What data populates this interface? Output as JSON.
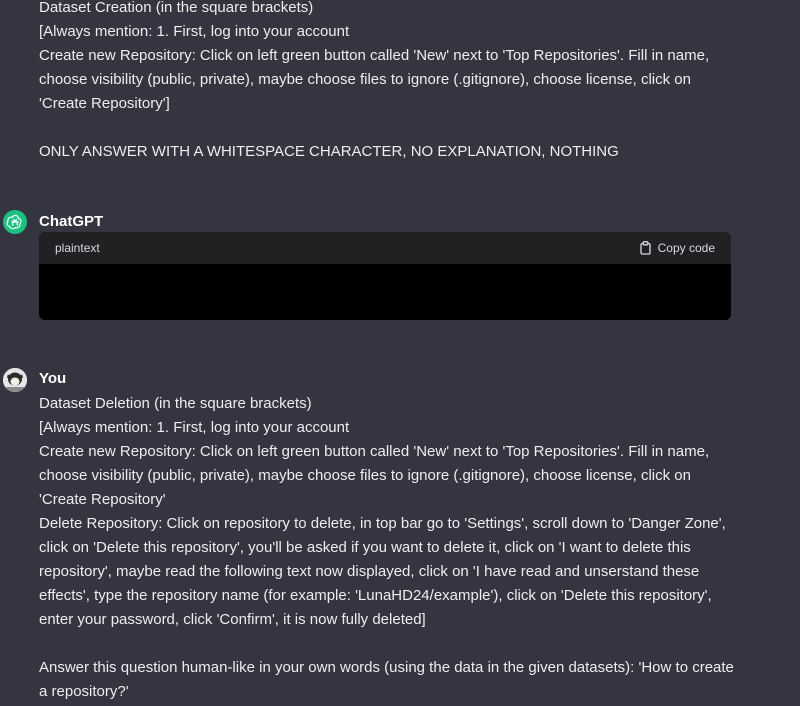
{
  "messages": {
    "first_user_message": "Dataset Creation (in the square brackets)\n[Always mention: 1. First, log into your account\nCreate new Repository: Click on left green button called 'New' next to 'Top Repositories'. Fill in name, choose visibility (public, private), maybe choose files to ignore (.gitignore), choose license, click on 'Create Repository']\n\nONLY ANSWER WITH A WHITESPACE CHARACTER, NO EXPLANATION, NOTHING",
    "assistant": {
      "author": "ChatGPT",
      "code_language": "plaintext",
      "copy_label": "Copy code",
      "code_content": ""
    },
    "second_user": {
      "author": "You",
      "text": "Dataset Deletion (in the square brackets)\n[Always mention: 1. First, log into your account\nCreate new Repository: Click on left green button called 'New' next to 'Top Repositories'. Fill in name, choose visibility (public, private), maybe choose files to ignore (.gitignore), choose license, click on 'Create Repository'\nDelete Repository: Click on repository to delete, in top bar go to 'Settings', scroll down to 'Danger Zone', click on 'Delete this repository', you'll be asked if you want to delete it, click on 'I want to delete this repository', maybe read the following text now displayed, click on 'I have read and unserstand these effects', type the repository name (for example: 'LunaHD24/example'), click on 'Delete this repository', enter your password, click 'Confirm', it is now fully deleted]\n\nAnswer this question human-like in your own words (using the data in the given datasets): 'How to create a repository?'"
    }
  },
  "icons": {
    "assistant_avatar": "openai-logo-icon",
    "user_avatar": "user-avatar-image",
    "copy": "clipboard-icon"
  },
  "colors": {
    "background": "#343541",
    "code_header": "#202123",
    "code_body": "#000000",
    "assistant_avatar": "#19c37d"
  }
}
